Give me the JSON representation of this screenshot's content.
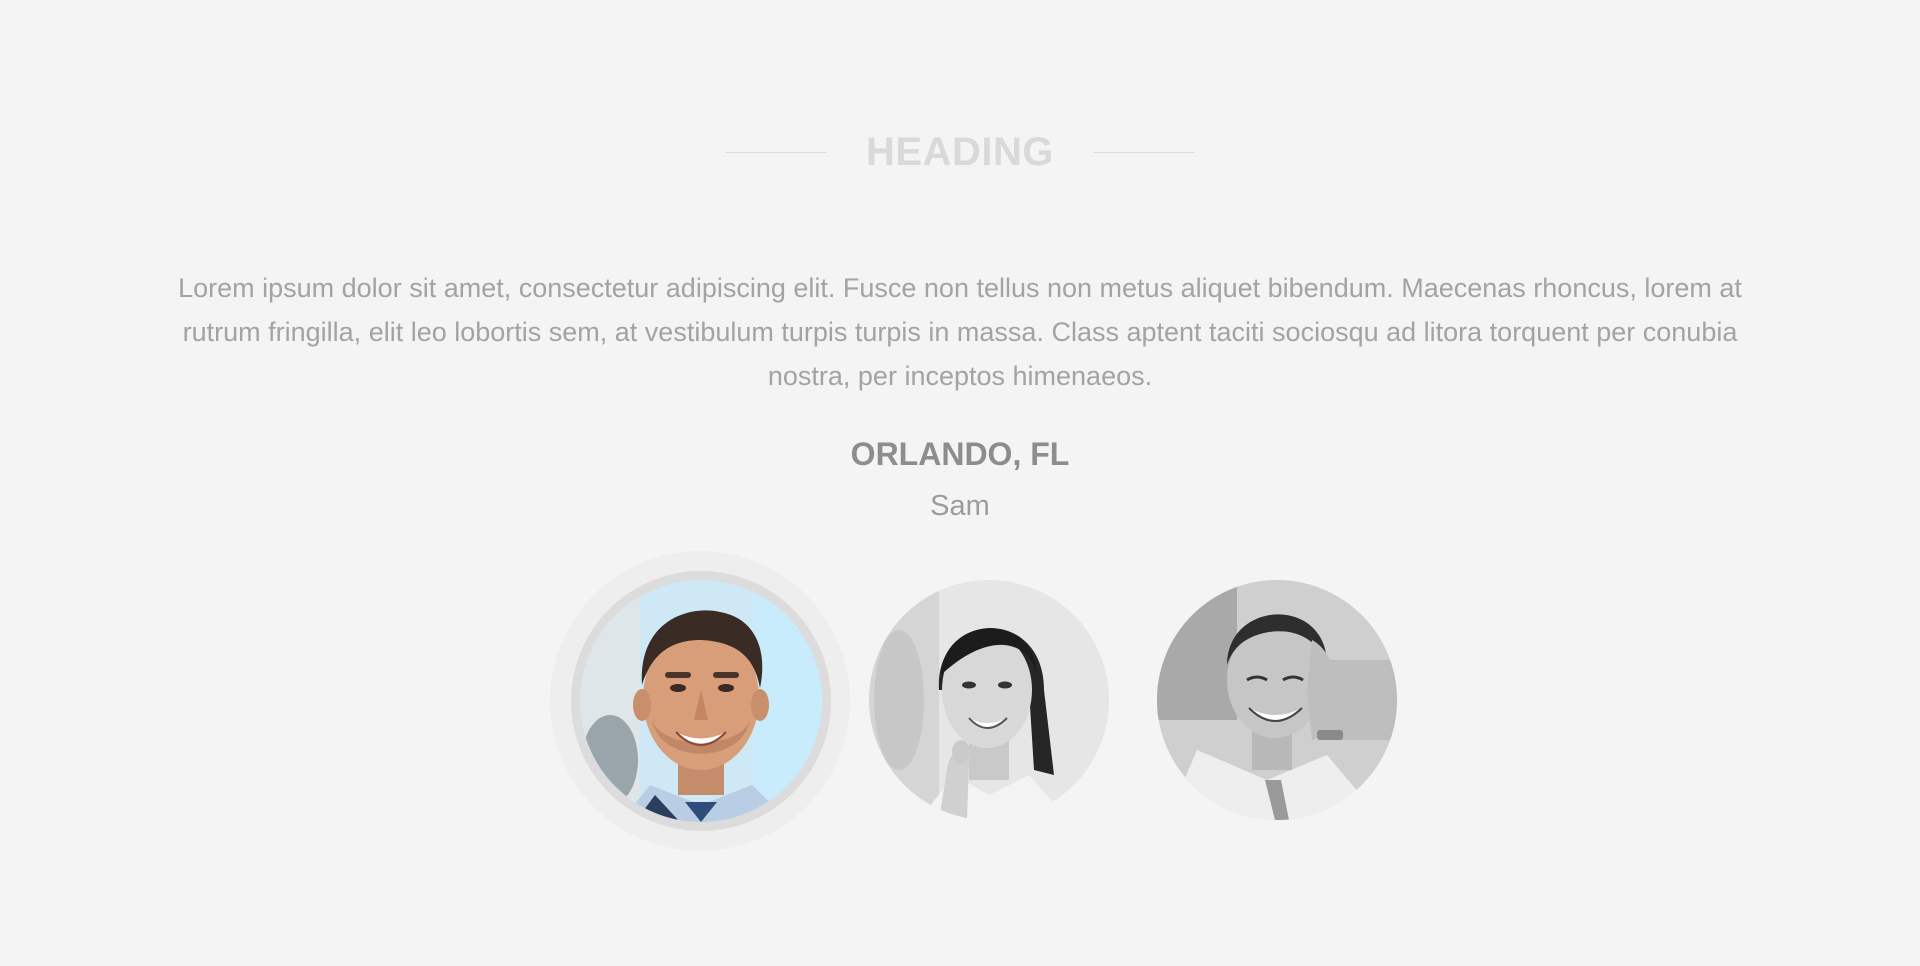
{
  "section": {
    "heading": "HEADING",
    "quote": "Lorem ipsum dolor sit amet, consectetur adipiscing elit. Fusce non tellus non metus aliquet bibendum. Maecenas rhoncus, lorem at rutrum fringilla, elit leo lobortis sem, at vestibulum turpis turpis in massa. Class aptent taciti sociosqu ad litora torquent per conubia nostra, per inceptos himenaeos.",
    "location": "ORLANDO, FL",
    "name": "Sam"
  },
  "avatars": [
    {
      "icon": "man-portrait-photo",
      "active": true,
      "tone": "color"
    },
    {
      "icon": "woman-portrait-photo",
      "active": false,
      "tone": "grayscale"
    },
    {
      "icon": "man-portrait-photo",
      "active": false,
      "tone": "grayscale"
    }
  ],
  "colors": {
    "background": "#f4f4f4",
    "heading": "#d9d9d9",
    "body_text": "#a3a3a3",
    "location": "#8d8d8d",
    "active_ring": "#dcdcdc"
  }
}
